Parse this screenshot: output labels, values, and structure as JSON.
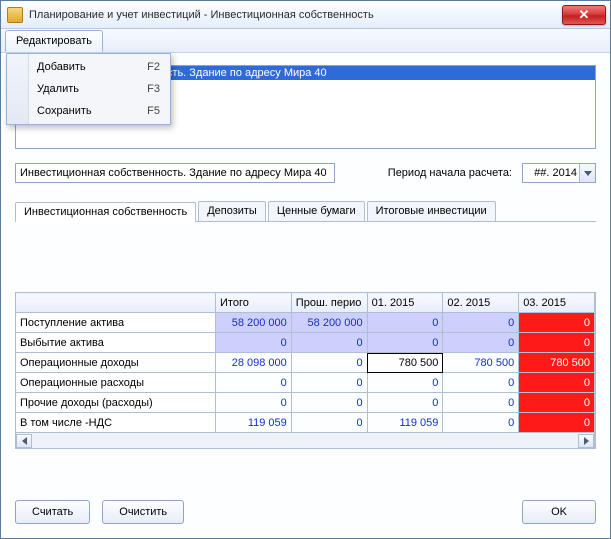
{
  "window": {
    "title": "Планирование и учет инвестиций - Инвестиционная собственность"
  },
  "menubar": {
    "edit": "Редактировать"
  },
  "dropdown": {
    "items": [
      {
        "label": "Добавить",
        "shortcut": "F2"
      },
      {
        "label": "Удалить",
        "shortcut": "F3"
      },
      {
        "label": "Сохранить",
        "shortcut": "F5"
      }
    ]
  },
  "listbox": {
    "items": [
      {
        "text": "Инвестиционная собственность. Здание по адресу Мира 40",
        "selected": true,
        "partial_visible": "ость. Здание по адресу Мира 40"
      }
    ]
  },
  "name_input": {
    "value": "Инвестиционная собственность. Здание по адресу Мира 40"
  },
  "period": {
    "label": "Период начала расчета:",
    "value": "##. 2014"
  },
  "tabs": {
    "items": [
      {
        "label": "Инвестиционная собственность",
        "active": true
      },
      {
        "label": "Депозиты"
      },
      {
        "label": "Ценные бумаги"
      },
      {
        "label": "Итоговые инвестиции"
      }
    ]
  },
  "grid": {
    "columns": [
      "",
      "Итого",
      "Прош. перио",
      "01. 2015",
      "02. 2015",
      "03. 2015"
    ],
    "rows": [
      {
        "label": "Поступление актива",
        "cells": [
          "58 200 000",
          "58 200 000",
          "0",
          "0",
          "0"
        ],
        "lav": true,
        "red_last": true
      },
      {
        "label": "Выбытие актива",
        "cells": [
          "0",
          "0",
          "0",
          "0",
          "0"
        ],
        "lav": true,
        "red_last": true
      },
      {
        "label": "Операционные доходы",
        "cells": [
          "28 098 000",
          "0",
          "780 500",
          "780 500",
          "780 500"
        ],
        "red_last": true,
        "focus_col": 2
      },
      {
        "label": "Операционные расходы",
        "cells": [
          "0",
          "0",
          "0",
          "0",
          "0"
        ],
        "red_last": true
      },
      {
        "label": "Прочие доходы (расходы)",
        "cells": [
          "0",
          "0",
          "0",
          "0",
          "0"
        ],
        "red_last": true
      },
      {
        "label": "В том числе -НДС",
        "cells": [
          "119 059",
          "0",
          "119 059",
          "0",
          "0"
        ],
        "red_last": true
      }
    ]
  },
  "footer": {
    "calc": "Считать",
    "clear": "Очистить",
    "ok": "OK"
  }
}
